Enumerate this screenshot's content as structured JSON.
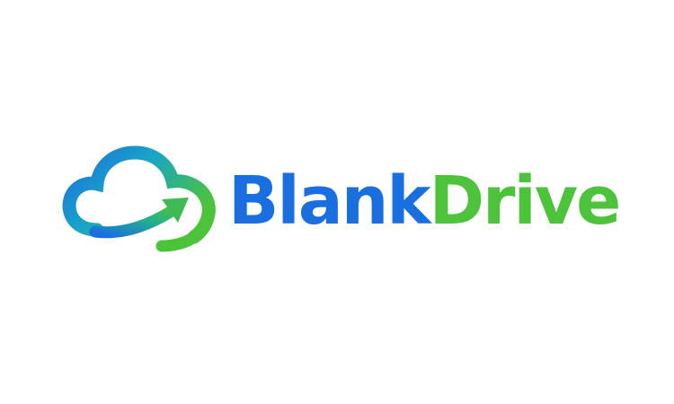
{
  "logo": {
    "word_primary": "Blank",
    "word_secondary": "Drive",
    "icon": "cloud-upload-arrow-icon",
    "colors": {
      "blue": "#1a6fe0",
      "green": "#4cc33a",
      "gradient_start": "#1a6fe0",
      "gradient_mid": "#19a4c7",
      "gradient_end": "#4cc33a"
    }
  }
}
